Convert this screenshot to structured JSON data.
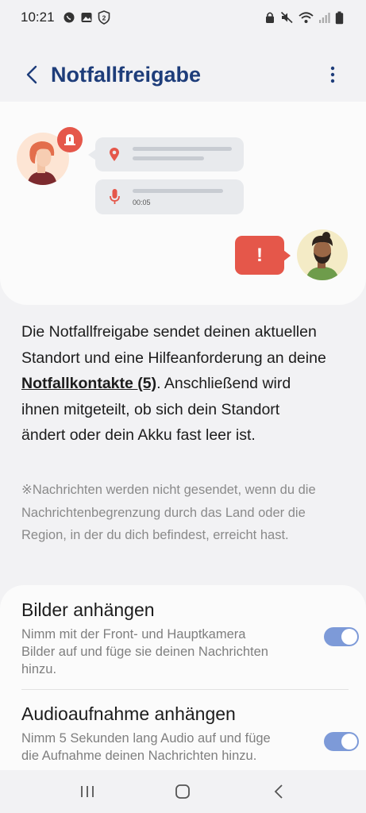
{
  "status_bar": {
    "time": "10:21",
    "left_icons": [
      "whatsapp-icon",
      "gallery-icon",
      "shield-2-icon"
    ],
    "right_icons": [
      "lock-icon",
      "mute-icon",
      "wifi-icon",
      "signal-icon",
      "battery-icon"
    ]
  },
  "app_bar": {
    "title": "Notfallfreigabe",
    "back_icon": "chevron-left-icon",
    "more_icon": "more-vertical-icon"
  },
  "illustration": {
    "audio_duration": "00:05",
    "alert_mark": "!"
  },
  "description": {
    "before_link": "Die Notfallfreigabe sendet deinen aktuellen Standort und eine Hilfeanforderung an deine ",
    "link_text": "Notfallkontakte (5)",
    "after_link": ". Anschließend wird ihnen mitgeteilt, ob sich dein Standort ändert oder dein Akku fast leer ist."
  },
  "note": "※Nachrichten werden nicht gesendet, wenn du die Nachrichtenbegrenzung durch das Land oder die Region, in der du dich befindest, erreicht hast.",
  "settings": [
    {
      "title": "Bilder anhängen",
      "subtitle": "Nimm mit der Front- und Hauptkamera Bilder auf und füge sie deinen Nachrichten hinzu.",
      "enabled": true
    },
    {
      "title": "Audioaufnahme anhängen",
      "subtitle": "Nimm 5 Sekunden lang Audio auf und füge die Aufnahme deinen Nachrichten hinzu.",
      "enabled": true
    }
  ],
  "colors": {
    "title": "#1e3d7a",
    "accent_red": "#e5574a",
    "toggle_on": "#7d9ad8"
  },
  "nav_bar": {
    "items": [
      "recent-apps-icon",
      "home-icon",
      "back-icon"
    ]
  }
}
